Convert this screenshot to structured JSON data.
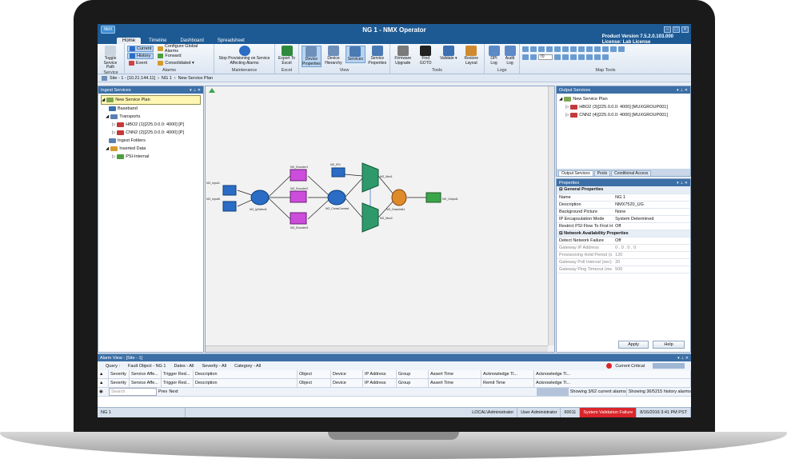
{
  "window": {
    "title": "NG 1 - NMX Operator",
    "app_icon": "NMX"
  },
  "tabs": [
    "Home",
    "Timeline",
    "Dashboard",
    "Spreadsheet"
  ],
  "product": {
    "version": "Product Version 7.5.2.0.103.000",
    "license": "License: Lab License"
  },
  "ribbon": {
    "service": {
      "label": "Service",
      "toggle": "Toggle Service Path"
    },
    "alarms": {
      "label": "Alarms",
      "current": "Current",
      "history": "History",
      "event": "Event",
      "configure": "Configure Global Alarms",
      "forward": "Forward",
      "consolidated": "Consolidated ▾"
    },
    "maintenance": {
      "label": "Maintenance",
      "stop": "Stop Provisioning on Service Affecting Alarms"
    },
    "excel": {
      "label": "Excel",
      "export": "Export To Excel"
    },
    "view": {
      "label": "View",
      "device_props": "Device Properties",
      "device_hier": "Device Hierarchy",
      "services": "Services",
      "service_props": "Service Properties"
    },
    "tools": {
      "label": "Tools",
      "firmware": "Firmware Upgrade",
      "find": "Find GOTO",
      "validate": "Validate ▾",
      "restore": "Restore Layout"
    },
    "logs": {
      "label": "Logs",
      "dpi": "DPI Log",
      "audit": "Audit Log"
    },
    "maptools": {
      "label": "Map Tools",
      "zoom": "70"
    }
  },
  "breadcrumb": {
    "site": "Site - 1 - [10.21.144.11]",
    "ng": "NG 1",
    "plan": "New Service Plan"
  },
  "ingest": {
    "title": "Ingest Services",
    "items": [
      "New Service Plan",
      "Baseband",
      "Transports",
      "HBO2 (1)[225.0.0.0: 4000] [P]",
      "CNN2 (2)[225.0.0.0: 4000] [P]",
      "Ingest Folders",
      "Inserted Data",
      "PSI-Internal"
    ]
  },
  "diagram": {
    "nodes": [
      "NG_Input1",
      "NG_Input6",
      "NG_IpSelect1",
      "NG_Encoder1",
      "NG_Encoder2",
      "NG_Encoder3",
      "NG_CrossConnect",
      "NG_IPd",
      "NG_Mux1",
      "NG_Mux2",
      "NG_Downlink1",
      "NG_Output1"
    ]
  },
  "output": {
    "title": "Output Services",
    "items": [
      "New Service Plan",
      "HBO2 (3)[225.0.0.0: 4000] [MUXGROUP001]",
      "CNN2 (4)[225.0.0.0: 4000] [MUXGROUP001]"
    ],
    "tabs": [
      "Output Services",
      "Pools",
      "Conditional Access"
    ]
  },
  "properties": {
    "title": "Properties",
    "general": "General Properties",
    "rows": [
      {
        "k": "Name",
        "v": "NG 1"
      },
      {
        "k": "Description",
        "v": "NMX7520_UG"
      },
      {
        "k": "Background Picture",
        "v": "None"
      },
      {
        "k": "IP Encapsulation Mode",
        "v": "System Determined"
      },
      {
        "k": "Restrict PSI Flow To First H",
        "v": "Off"
      }
    ],
    "network": "Network Availability Properties",
    "rows2": [
      {
        "k": "Detect Network Failure",
        "v": "Off"
      },
      {
        "k": "Gateway IP Address",
        "v": "0 . 0 . 0 . 0"
      },
      {
        "k": "Provisioning Hold Period (s",
        "v": "120"
      },
      {
        "k": "Gateway Poll Interval (sec)",
        "v": "30"
      },
      {
        "k": "Gateway Ping Timeout (ms",
        "v": "500"
      }
    ],
    "apply": "Apply",
    "help": "Help"
  },
  "alarm": {
    "title": "Alarm View - [Site - 1]",
    "query": "Query :",
    "fault": "Fault Object - NG 1",
    "dates": "Dates - All",
    "severity": "Severity - All",
    "category": "Category - All",
    "critical": "Current Critical",
    "cols1": [
      "Severity",
      "Service Affe...",
      "Trigger Red...",
      "Description",
      "Object",
      "Device",
      "IP Address",
      "Group",
      "Assert Time",
      "Acknowledge Ti...",
      "Acknowledge Ti..."
    ],
    "cols2": [
      "Severity",
      "Service Affe...",
      "Trigger Red...",
      "Description",
      "Object",
      "Device",
      "IP Address",
      "Group",
      "Assert Time",
      "Remit Time",
      "Acknowledge Ti..."
    ],
    "search": "Search",
    "prev": "Prev",
    "next": "Next",
    "showing1": "Showing 3/62 current alarms",
    "showing2": "Showing 36/5215 history alarms"
  },
  "status": {
    "ng": "NG 1",
    "local": "LOCAL\\Administrator",
    "user": "User Administrator",
    "port": "60011",
    "validation": "System Validation Failure",
    "datetime": "8/16/2016 3:41 PM PST"
  }
}
